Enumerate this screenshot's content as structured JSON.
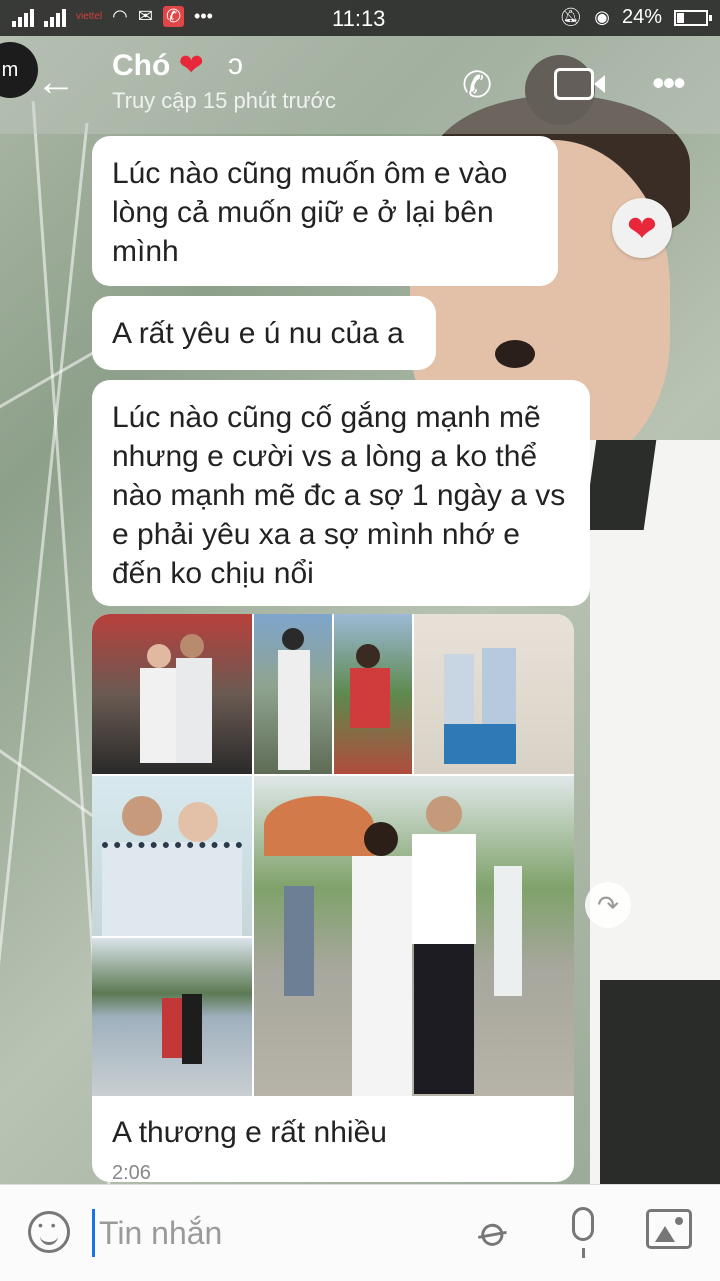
{
  "status_bar": {
    "time": "11:13",
    "battery": "24%",
    "battery_level": 0.24,
    "carrier_badge": "viettel"
  },
  "header": {
    "avatar_text": "m",
    "contact_name": "Chó",
    "name_emoji": "❤",
    "last_seen": "Truy cập 15 phút trước"
  },
  "messages": [
    {
      "text": "Lúc nào cũng muốn ôm e vào lòng cả muốn giữ e ở lại bên mình",
      "reaction": "❤"
    },
    {
      "text": "A rất yêu e ú nu của a"
    },
    {
      "text": "Lúc nào cũng cố gắng mạnh mẽ nhưng e cười vs a lòng a ko thể nào mạnh mẽ đc a sợ 1 ngày a vs e phải yêu xa a sợ mình nhớ e đến ko chịu nổi"
    }
  ],
  "photo_message": {
    "caption": "A thương e rất nhiều",
    "time": "2:06"
  },
  "composer": {
    "placeholder": "Tin nhắn"
  },
  "colors": {
    "bubble_bg": "#ffffff",
    "heart": "#e8283a",
    "cursor": "#1a73e8"
  }
}
